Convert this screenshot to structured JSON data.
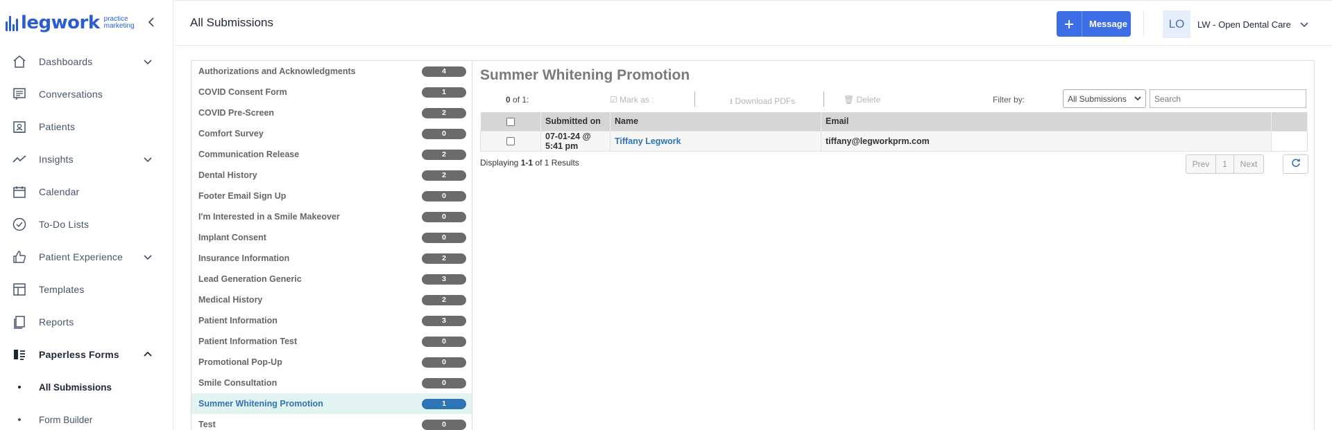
{
  "brand": {
    "name": "legwork",
    "tagline_line1": "practice",
    "tagline_line2": "marketing",
    "color": "#2a5cd6"
  },
  "sidebar": {
    "items": [
      {
        "label": "Dashboards",
        "icon": "home-icon",
        "has_chevron": true
      },
      {
        "label": "Conversations",
        "icon": "chat-icon",
        "has_chevron": false
      },
      {
        "label": "Patients",
        "icon": "patients-icon",
        "has_chevron": false
      },
      {
        "label": "Insights",
        "icon": "trend-icon",
        "has_chevron": true
      },
      {
        "label": "Calendar",
        "icon": "calendar-icon",
        "has_chevron": false
      },
      {
        "label": "To-Do Lists",
        "icon": "check-circle-icon",
        "has_chevron": false
      },
      {
        "label": "Patient Experience",
        "icon": "thumbs-up-icon",
        "has_chevron": true
      },
      {
        "label": "Templates",
        "icon": "template-icon",
        "has_chevron": false
      },
      {
        "label": "Reports",
        "icon": "reports-icon",
        "has_chevron": false
      },
      {
        "label": "Paperless Forms",
        "icon": "forms-icon",
        "has_chevron": true,
        "expanded": true
      }
    ],
    "subitems": [
      {
        "label": "All Submissions",
        "active": true
      },
      {
        "label": "Form Builder",
        "active": false
      }
    ]
  },
  "header": {
    "title": "All Submissions",
    "message_button": "Message",
    "avatar_initials": "LO",
    "account_name": "LW - Open Dental Care"
  },
  "forms": [
    {
      "name": "Authorizations and Acknowledgments",
      "count": "4"
    },
    {
      "name": "COVID Consent Form",
      "count": "1"
    },
    {
      "name": "COVID Pre-Screen",
      "count": "2"
    },
    {
      "name": "Comfort Survey",
      "count": "0"
    },
    {
      "name": "Communication Release",
      "count": "2"
    },
    {
      "name": "Dental History",
      "count": "2"
    },
    {
      "name": "Footer Email Sign Up",
      "count": "0"
    },
    {
      "name": "I'm Interested in a Smile Makeover",
      "count": "0"
    },
    {
      "name": "Implant Consent",
      "count": "0"
    },
    {
      "name": "Insurance Information",
      "count": "2"
    },
    {
      "name": "Lead Generation Generic",
      "count": "3"
    },
    {
      "name": "Medical History",
      "count": "2"
    },
    {
      "name": "Patient Information",
      "count": "3"
    },
    {
      "name": "Patient Information Test",
      "count": "0"
    },
    {
      "name": "Promotional Pop-Up",
      "count": "0"
    },
    {
      "name": "Smile Consultation",
      "count": "0"
    },
    {
      "name": "Summer Whitening Promotion",
      "count": "1",
      "active": true
    },
    {
      "name": "Test",
      "count": "0"
    }
  ],
  "detail": {
    "title": "Summer Whitening Promotion",
    "selected_count": "0",
    "selected_of": "of 1:",
    "mark_as": "Mark as :",
    "download_pdfs": "Download PDFs",
    "delete": "Delete",
    "filter_label": "Filter by:",
    "filter_value": "All Submissions",
    "search_placeholder": "Search",
    "columns": [
      "Submitted on",
      "Name",
      "Email"
    ],
    "rows": [
      {
        "submitted_on": "07-01-24 @ 5:41 pm",
        "name": "Tiffany Legwork",
        "email": "tiffany@legworkprm.com"
      }
    ],
    "results_prefix": "Displaying",
    "results_range": "1-1",
    "results_of": "of",
    "results_total": "1",
    "results_suffix": "Results",
    "pager": {
      "prev": "Prev",
      "page": "1",
      "next": "Next"
    }
  },
  "colors": {
    "accent": "#3e6ee6",
    "active_row_bg": "#e2f3f1",
    "link_blue": "#2f74b5",
    "badge_gray": "#6b6b6b"
  }
}
